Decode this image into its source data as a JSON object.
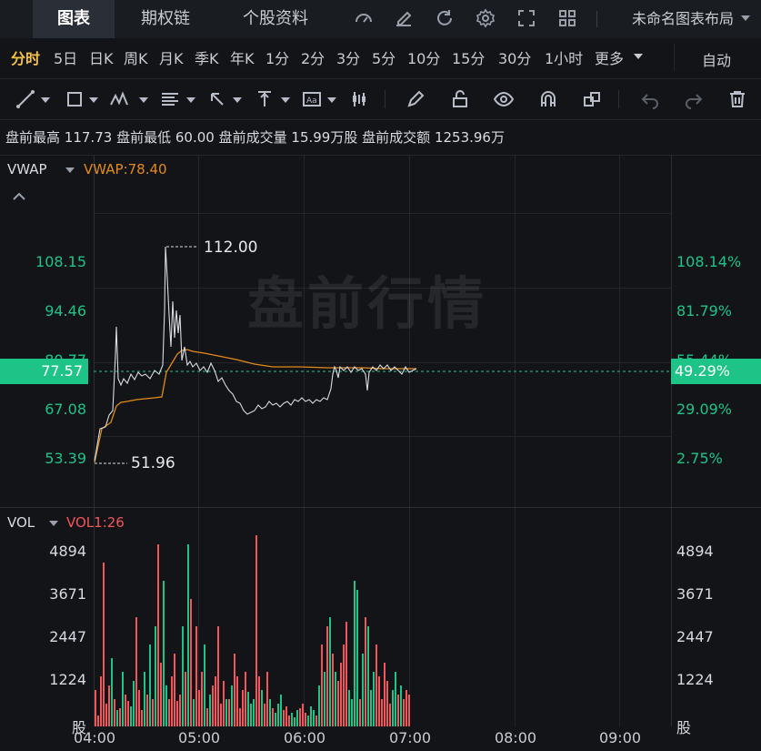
{
  "topbar": {
    "tabs": [
      "图表",
      "期权链",
      "个股资料"
    ],
    "active_tab": "图表",
    "layout_name": "未命名图表布局",
    "icons": [
      "indicator-icon",
      "draw-icon",
      "refresh-icon",
      "settings-icon",
      "fullscreen-icon",
      "layout-grid-icon"
    ]
  },
  "periods": {
    "items": [
      "分时",
      "5日",
      "日K",
      "周K",
      "月K",
      "季K",
      "年K",
      "1分",
      "2分",
      "3分",
      "5分",
      "10分",
      "15分",
      "30分",
      "1小时",
      "更多"
    ],
    "active": "分时",
    "mode": "自动"
  },
  "toolbar": {
    "icons": [
      "trend-line-icon",
      "rectangle-icon",
      "pattern-icon",
      "fib-icon",
      "arrow-icon",
      "measure-icon",
      "text-icon",
      "candle-icon",
      "pencil-icon",
      "lock-icon",
      "eye-icon",
      "magnet-icon",
      "clone-icon",
      "undo-icon",
      "redo-icon",
      "delete-icon"
    ]
  },
  "premarket": {
    "high_label": "盘前最高",
    "high": "117.73",
    "low_label": "盘前最低",
    "low": "60.00",
    "vol_label": "盘前成交量",
    "vol": "15.99万股",
    "amt_label": "盘前成交额",
    "amt": "1253.96万"
  },
  "price_pane": {
    "indicator": "VWAP",
    "indicator_value": "VWAP:78.40",
    "watermark": "盘前行情",
    "left_ticks": [
      "108.15",
      "94.46",
      "80.77",
      "67.08",
      "53.39"
    ],
    "right_ticks": [
      "108.14%",
      "81.79%",
      "55.44%",
      "29.09%",
      "2.75%"
    ],
    "current_price": "77.57",
    "current_pct": "49.29%",
    "high_marker": "112.00",
    "low_marker": "51.96",
    "colors": {
      "up": "#1ec387",
      "price_line": "#d9dce2",
      "vwap_line": "#e38b1a"
    }
  },
  "volume_pane": {
    "indicator": "VOL",
    "indicator_value": "VOL1:26",
    "left_ticks": [
      "4894",
      "3671",
      "2447",
      "1224",
      "股"
    ],
    "right_ticks": [
      "4894",
      "3671",
      "2447",
      "1224",
      "股"
    ],
    "colors": {
      "up": "#1ec387",
      "down": "#f2555a"
    }
  },
  "time_axis": [
    "04:00",
    "05:00",
    "06:00",
    "07:00",
    "08:00",
    "09:00"
  ]
}
